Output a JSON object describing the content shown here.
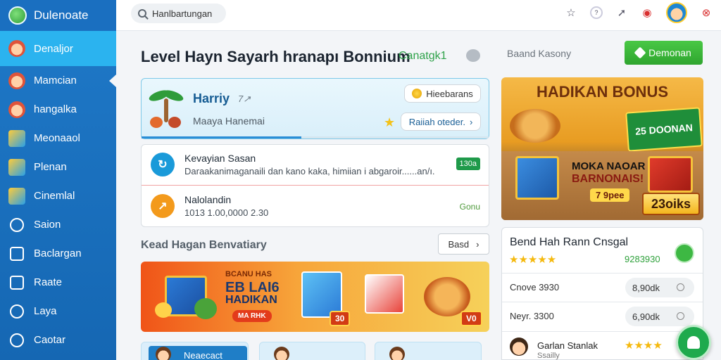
{
  "app": {
    "name": "Dulenoate"
  },
  "sidebar": {
    "items": [
      {
        "label": "Denaljor",
        "icon": "avatar-face-icon",
        "active": true
      },
      {
        "label": "Mamcian",
        "icon": "avatar-face-icon"
      },
      {
        "label": "hangalka",
        "icon": "avatar-girl-icon"
      },
      {
        "label": "Meonaaol",
        "icon": "book-icon"
      },
      {
        "label": "Plenan",
        "icon": "folder-icon"
      },
      {
        "label": "Cinemlal",
        "icon": "book-icon"
      },
      {
        "label": "Saion",
        "icon": "chat-bubble-icon"
      },
      {
        "label": "Baclargan",
        "icon": "edit-icon"
      },
      {
        "label": "Raate",
        "icon": "home-icon"
      },
      {
        "label": "Laya",
        "icon": "globe-icon"
      },
      {
        "label": "Caotar",
        "icon": "globe-icon"
      }
    ]
  },
  "topbar": {
    "search_value": "Hanlbartungan",
    "icons": [
      "star-icon",
      "help-icon",
      "send-icon",
      "record-icon",
      "profile-avatar",
      "close-icon"
    ]
  },
  "main": {
    "title": "Level Hayn Sayarh hranapı Bonnium",
    "link": "Canatgk1",
    "right_heading": "Baand Kasony",
    "cta_label": "Demonan"
  },
  "profile": {
    "name": "Harriy",
    "badge": "7↗",
    "subtitle": "Maaya Hanemai",
    "pill_top": "Hieebarans",
    "pill_bottom": "Raiiah oteder.",
    "progress": 0.46
  },
  "activity": [
    {
      "title": "Kevayian Sasan",
      "desc": "Daraakanimaganaili dan kano kaka, himiian i abgaroir......an/ı.",
      "tag": "130a"
    },
    {
      "title": "Nalolandin",
      "desc": "1013 1.00,0000 2.30",
      "status": "Gonu"
    }
  ],
  "section": {
    "title": "Kead Hagan Benvatiary",
    "button": "Basd"
  },
  "promo": {
    "kicker": "BCANU HAS",
    "big": "EB LAI6",
    "mid": "HADIKAN",
    "pill": "MA RHK",
    "badge1": "30",
    "badge2": "V0"
  },
  "bottom_cards": [
    {
      "label": "Neaecact"
    },
    {
      "label": ""
    },
    {
      "label": ""
    }
  ],
  "bonus": {
    "title": "HADIKAN BONUS",
    "green": "25 DOONAN",
    "headline": "MOKA NAOAR",
    "headline2": "BARNONAIS!",
    "chip": "7 9pee",
    "price": "23oiks"
  },
  "reviews": {
    "title": "Bend Hah Rann Cnsgal",
    "rating": 5,
    "score": "9283930",
    "rows": [
      {
        "label": "Cnove 3930",
        "pill": "8,90dk"
      },
      {
        "label": "Neyr. 3300",
        "pill": "6,90dk"
      }
    ],
    "reviewer": {
      "name": "Garlan Stanlak",
      "sub": "Ssailly",
      "rating": 4
    }
  },
  "colors": {
    "sidebar": "#1f79c8",
    "active": "#2bb3ef",
    "accent_green": "#2fa52f"
  }
}
